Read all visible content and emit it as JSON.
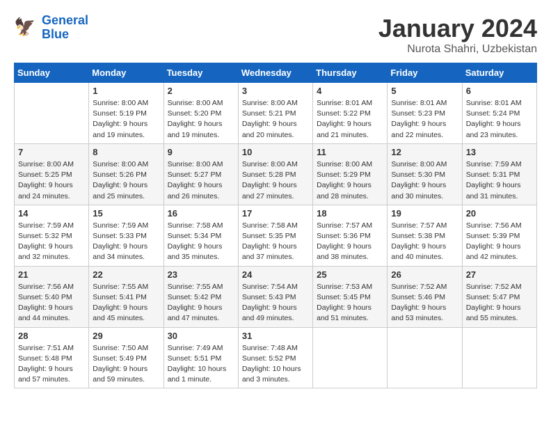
{
  "header": {
    "logo_line1": "General",
    "logo_line2": "Blue",
    "month": "January 2024",
    "location": "Nurota Shahri, Uzbekistan"
  },
  "weekdays": [
    "Sunday",
    "Monday",
    "Tuesday",
    "Wednesday",
    "Thursday",
    "Friday",
    "Saturday"
  ],
  "weeks": [
    [
      {
        "day": "",
        "info": ""
      },
      {
        "day": "1",
        "info": "Sunrise: 8:00 AM\nSunset: 5:19 PM\nDaylight: 9 hours\nand 19 minutes."
      },
      {
        "day": "2",
        "info": "Sunrise: 8:00 AM\nSunset: 5:20 PM\nDaylight: 9 hours\nand 19 minutes."
      },
      {
        "day": "3",
        "info": "Sunrise: 8:00 AM\nSunset: 5:21 PM\nDaylight: 9 hours\nand 20 minutes."
      },
      {
        "day": "4",
        "info": "Sunrise: 8:01 AM\nSunset: 5:22 PM\nDaylight: 9 hours\nand 21 minutes."
      },
      {
        "day": "5",
        "info": "Sunrise: 8:01 AM\nSunset: 5:23 PM\nDaylight: 9 hours\nand 22 minutes."
      },
      {
        "day": "6",
        "info": "Sunrise: 8:01 AM\nSunset: 5:24 PM\nDaylight: 9 hours\nand 23 minutes."
      }
    ],
    [
      {
        "day": "7",
        "info": "Sunrise: 8:00 AM\nSunset: 5:25 PM\nDaylight: 9 hours\nand 24 minutes."
      },
      {
        "day": "8",
        "info": "Sunrise: 8:00 AM\nSunset: 5:26 PM\nDaylight: 9 hours\nand 25 minutes."
      },
      {
        "day": "9",
        "info": "Sunrise: 8:00 AM\nSunset: 5:27 PM\nDaylight: 9 hours\nand 26 minutes."
      },
      {
        "day": "10",
        "info": "Sunrise: 8:00 AM\nSunset: 5:28 PM\nDaylight: 9 hours\nand 27 minutes."
      },
      {
        "day": "11",
        "info": "Sunrise: 8:00 AM\nSunset: 5:29 PM\nDaylight: 9 hours\nand 28 minutes."
      },
      {
        "day": "12",
        "info": "Sunrise: 8:00 AM\nSunset: 5:30 PM\nDaylight: 9 hours\nand 30 minutes."
      },
      {
        "day": "13",
        "info": "Sunrise: 7:59 AM\nSunset: 5:31 PM\nDaylight: 9 hours\nand 31 minutes."
      }
    ],
    [
      {
        "day": "14",
        "info": "Sunrise: 7:59 AM\nSunset: 5:32 PM\nDaylight: 9 hours\nand 32 minutes."
      },
      {
        "day": "15",
        "info": "Sunrise: 7:59 AM\nSunset: 5:33 PM\nDaylight: 9 hours\nand 34 minutes."
      },
      {
        "day": "16",
        "info": "Sunrise: 7:58 AM\nSunset: 5:34 PM\nDaylight: 9 hours\nand 35 minutes."
      },
      {
        "day": "17",
        "info": "Sunrise: 7:58 AM\nSunset: 5:35 PM\nDaylight: 9 hours\nand 37 minutes."
      },
      {
        "day": "18",
        "info": "Sunrise: 7:57 AM\nSunset: 5:36 PM\nDaylight: 9 hours\nand 38 minutes."
      },
      {
        "day": "19",
        "info": "Sunrise: 7:57 AM\nSunset: 5:38 PM\nDaylight: 9 hours\nand 40 minutes."
      },
      {
        "day": "20",
        "info": "Sunrise: 7:56 AM\nSunset: 5:39 PM\nDaylight: 9 hours\nand 42 minutes."
      }
    ],
    [
      {
        "day": "21",
        "info": "Sunrise: 7:56 AM\nSunset: 5:40 PM\nDaylight: 9 hours\nand 44 minutes."
      },
      {
        "day": "22",
        "info": "Sunrise: 7:55 AM\nSunset: 5:41 PM\nDaylight: 9 hours\nand 45 minutes."
      },
      {
        "day": "23",
        "info": "Sunrise: 7:55 AM\nSunset: 5:42 PM\nDaylight: 9 hours\nand 47 minutes."
      },
      {
        "day": "24",
        "info": "Sunrise: 7:54 AM\nSunset: 5:43 PM\nDaylight: 9 hours\nand 49 minutes."
      },
      {
        "day": "25",
        "info": "Sunrise: 7:53 AM\nSunset: 5:45 PM\nDaylight: 9 hours\nand 51 minutes."
      },
      {
        "day": "26",
        "info": "Sunrise: 7:52 AM\nSunset: 5:46 PM\nDaylight: 9 hours\nand 53 minutes."
      },
      {
        "day": "27",
        "info": "Sunrise: 7:52 AM\nSunset: 5:47 PM\nDaylight: 9 hours\nand 55 minutes."
      }
    ],
    [
      {
        "day": "28",
        "info": "Sunrise: 7:51 AM\nSunset: 5:48 PM\nDaylight: 9 hours\nand 57 minutes."
      },
      {
        "day": "29",
        "info": "Sunrise: 7:50 AM\nSunset: 5:49 PM\nDaylight: 9 hours\nand 59 minutes."
      },
      {
        "day": "30",
        "info": "Sunrise: 7:49 AM\nSunset: 5:51 PM\nDaylight: 10 hours\nand 1 minute."
      },
      {
        "day": "31",
        "info": "Sunrise: 7:48 AM\nSunset: 5:52 PM\nDaylight: 10 hours\nand 3 minutes."
      },
      {
        "day": "",
        "info": ""
      },
      {
        "day": "",
        "info": ""
      },
      {
        "day": "",
        "info": ""
      }
    ]
  ]
}
